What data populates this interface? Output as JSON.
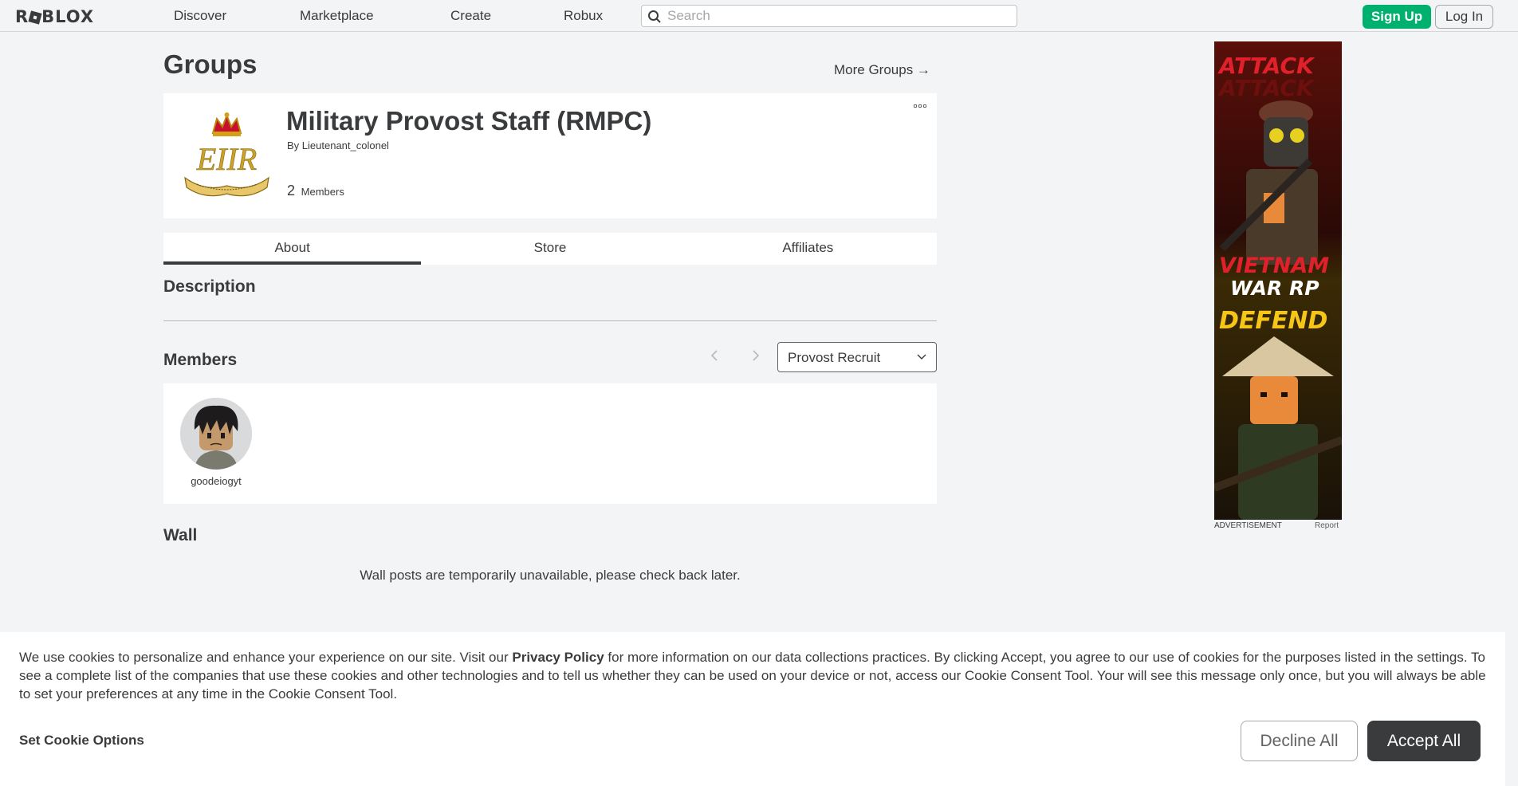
{
  "nav": {
    "logo": "ROBLOX",
    "links": [
      "Discover",
      "Marketplace",
      "Create",
      "Robux"
    ],
    "search_placeholder": "Search",
    "signup": "Sign Up",
    "login": "Log In"
  },
  "page": {
    "title": "Groups",
    "more_groups": "More Groups →"
  },
  "group": {
    "name": "Military Provost Staff (RMPC)",
    "by_label": "By",
    "owner": "Lieutenant_colonel",
    "member_count": "2",
    "members_label": "Members"
  },
  "tabs": [
    "About",
    "Store",
    "Affiliates"
  ],
  "active_tab": "About",
  "sections": {
    "description": "Description",
    "members": "Members",
    "wall": "Wall"
  },
  "members": {
    "role_selected": "Provost Recruit",
    "list": [
      {
        "username": "goodeiogyt"
      }
    ]
  },
  "wall_message": "Wall posts are temporarily unavailable, please check back later.",
  "ad": {
    "label": "ADVERTISEMENT",
    "report": "Report",
    "text_top": "ATTACK",
    "text_mid1": "VIETNAM",
    "text_mid2": "WAR RP",
    "text_bottom": "DEFEND"
  },
  "cookie": {
    "text_before": "We use cookies to personalize and enhance your experience on our site. Visit our ",
    "privacy_link": "Privacy Policy",
    "text_after": " for more information on our data collections practices. By clicking Accept, you agree to our use of cookies for the purposes listed in the settings. To see a complete list of the companies that use these cookies and other technologies and to tell us whether they can be used on your device or not, access our Cookie Consent Tool. Your will see this message only once, but you will always be able to set your preferences at any time in the Cookie Consent Tool.",
    "set_options": "Set Cookie Options",
    "decline": "Decline All",
    "accept": "Accept All"
  },
  "colors": {
    "signup_green": "#00b06f",
    "text_dark": "#393b3d",
    "background": "#f2f4f5",
    "accept_button": "#393b3d"
  }
}
